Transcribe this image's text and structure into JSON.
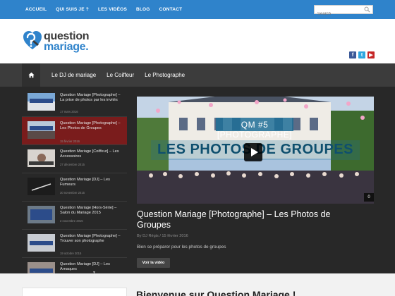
{
  "topbar": {
    "nav": [
      "ACCUEIL",
      "QUI SUIS JE ?",
      "LES VIDÉOS",
      "BLOG",
      "CONTACT"
    ],
    "search_placeholder": "Search"
  },
  "logo": {
    "line1": "question",
    "line2": "mariage."
  },
  "socials": [
    "facebook-icon",
    "twitter-icon",
    "youtube-icon"
  ],
  "mainnav": {
    "items": [
      "Le DJ de mariage",
      "Le Coiffeur",
      "Le Photographe"
    ]
  },
  "sidebar": {
    "items": [
      {
        "title": "Question Mariage [Photographe] – La prise de photos par les invités",
        "date": "17 mars 2016"
      },
      {
        "title": "Question Mariage [Photographe] – Les Photos de Groupes",
        "date": "15 février 2016"
      },
      {
        "title": "Question Mariage [Coiffeur] – Les Accessoires",
        "date": "27 décembre 2015"
      },
      {
        "title": "Question Mariage [DJ] – Les Fumeurs",
        "date": "30 novembre 2015"
      },
      {
        "title": "Question Mariage [Hors-Série] – Salon du Mariage 2015",
        "date": "2 novembre 2015"
      },
      {
        "title": "Question Mariage [Photographe] – Trouver son photographe",
        "date": "19 octobre 2015"
      },
      {
        "title": "Question Mariage [DJ] – Les Arnaques",
        "date": ""
      }
    ],
    "active_index": 1
  },
  "feature": {
    "overlay_top": "QM #5 [PHOTOGRAPHE]",
    "overlay_main": "LES PHOTOS DE GROUPES",
    "badge": "0",
    "title": "Question Mariage [Photographe] – Les Photos de Groupes",
    "meta": "By DJ Régis / 15 février 2016",
    "excerpt": "Bien se préparer pour les photos de groupes",
    "button": "Voir la vidéo"
  },
  "bottom": {
    "welcome": "Bienvenue sur Question Mariage !"
  },
  "colors": {
    "topbar": "#2f83cb",
    "nav": "#3c3c3c",
    "content": "#282828",
    "active": "#7a1c1c"
  }
}
